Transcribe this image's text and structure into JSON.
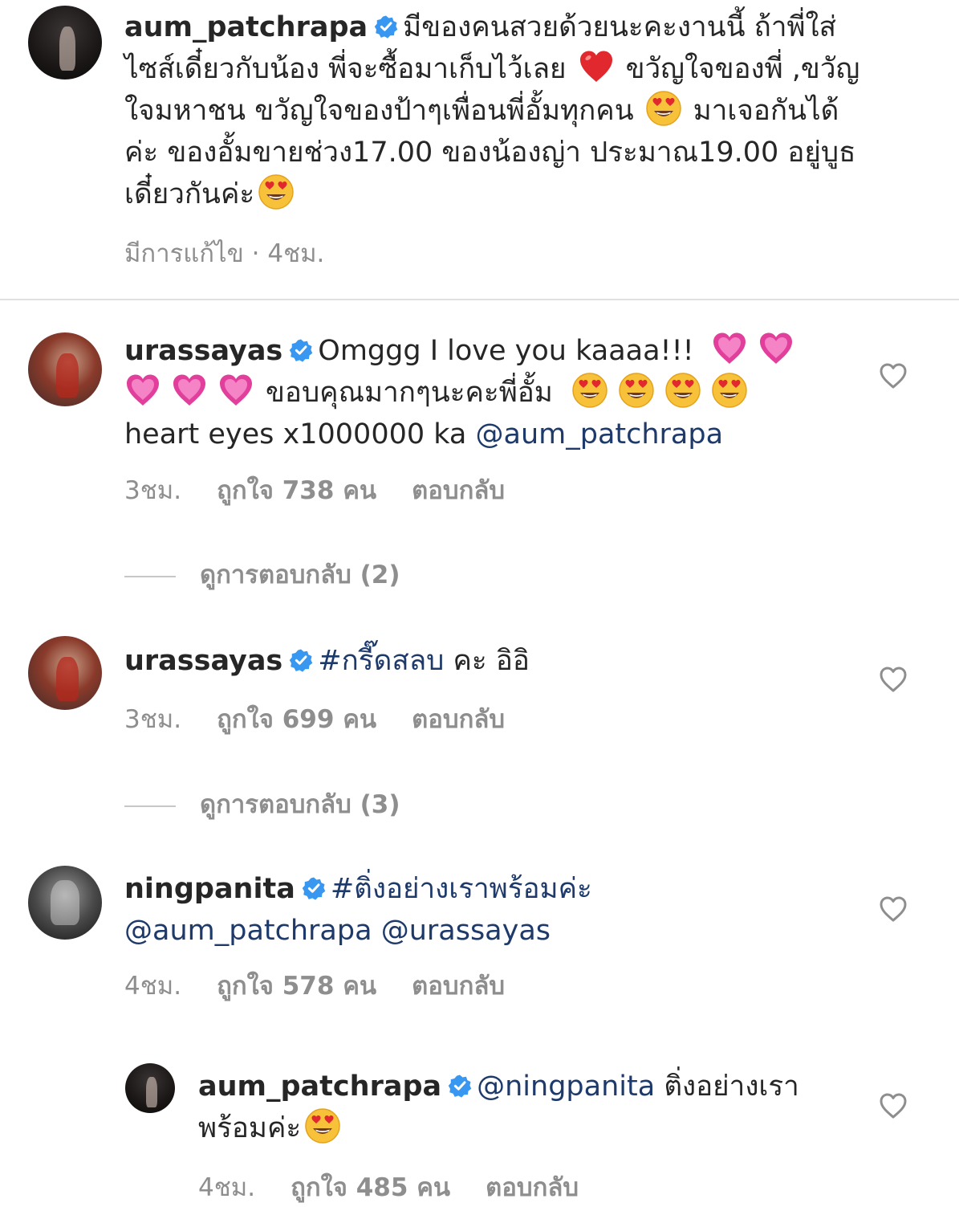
{
  "caption": {
    "username": "aum_patchrapa",
    "line1": "มีของคนสวยด้วยนะคะงานนี้ ถ้าพี่ใส่",
    "line2a": "ไซส์เดี๋ยวกับน้อง พี่จะซื้อมาเก็บไว้เลย",
    "line2b": "ขวัญใจของพี่ ,ขวัญ",
    "line3a": "ใจมหาชน ขวัญใจของป้าๆเพื่อนพี่อั้มทุกคน",
    "line3b": "มาเจอกันได้",
    "line4": "ค่ะ ของอั้มขายช่วง17.00 ของน้องญ่า ประมาณ19.00 อยู่บูธ",
    "line5": "เดี๋ยวกันค่ะ",
    "meta": "มีการแก้ไข · 4ชม."
  },
  "comments": [
    {
      "username": "urassayas",
      "line1": "Omggg I love you kaaaa!!!",
      "line2": "ขอบคุณมากๆนะคะพี่อั้ม",
      "line3a": "heart eyes x1000000 ka",
      "mention": "@aum_patchrapa",
      "time": "3ชม.",
      "likes": "ถูกใจ 738 คน",
      "reply": "ตอบกลับ",
      "view_replies": "ดูการตอบกลับ (2)"
    },
    {
      "username": "urassayas",
      "hashtag": "#กรี๊ดสลบ",
      "text": "คะ อิอิ",
      "time": "3ชม.",
      "likes": "ถูกใจ 699 คน",
      "reply": "ตอบกลับ",
      "view_replies": "ดูการตอบกลับ (3)"
    },
    {
      "username": "ningpanita",
      "hashtag": "#ติ่งอย่างเราพร้อมค่ะ",
      "mention1": "@aum_patchrapa",
      "mention2": "@urassayas",
      "time": "4ชม.",
      "likes": "ถูกใจ 578 คน",
      "reply": "ตอบกลับ"
    },
    {
      "username": "aum_patchrapa",
      "mention": "@ningpanita",
      "text1": "ติ่งอย่างเรา",
      "text2": "พร้อมค่ะ",
      "time": "4ชม.",
      "likes": "ถูกใจ 485 คน",
      "reply": "ตอบกลับ"
    }
  ],
  "colors": {
    "text": "#262626",
    "meta": "#8e8e8e",
    "link": "#1d3a6b",
    "verified": "#3897f0",
    "heart": "#e0282e"
  },
  "icons": [
    "verified-badge-icon",
    "heart-outline-icon",
    "red-heart-emoji",
    "heart-eyes-emoji",
    "pink-heart-emoji"
  ]
}
